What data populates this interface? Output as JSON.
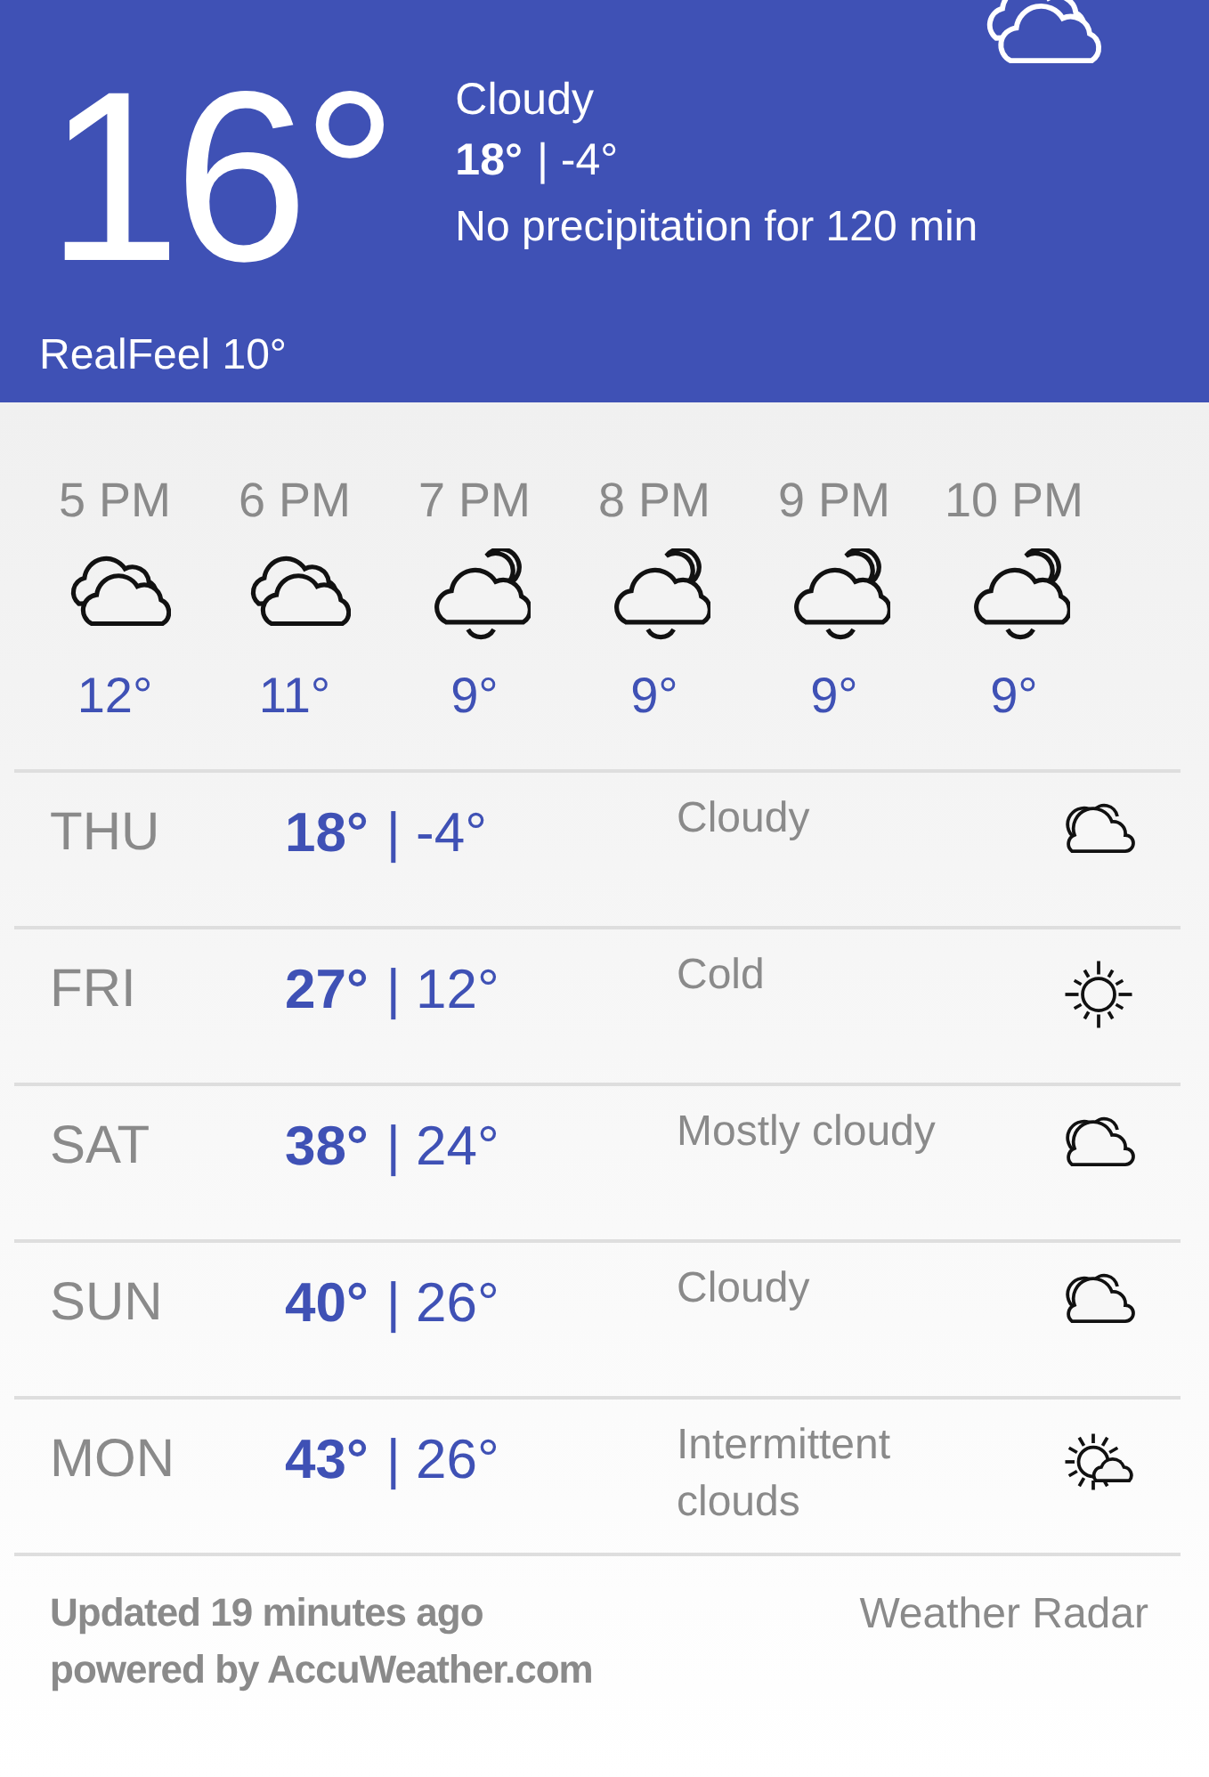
{
  "current": {
    "temperature": "16°",
    "condition": "Cloudy",
    "high": "18°",
    "low": "| -4°",
    "precipitation": "No precipitation for 120 min",
    "realfeel": "RealFeel 10°",
    "kind": "clouds"
  },
  "hourly": [
    {
      "time": "5 PM",
      "kind": "clouds",
      "temp": "12°"
    },
    {
      "time": "6 PM",
      "kind": "clouds",
      "temp": "11°"
    },
    {
      "time": "7 PM",
      "kind": "night_cloud",
      "temp": "9°"
    },
    {
      "time": "8 PM",
      "kind": "night_cloud",
      "temp": "9°"
    },
    {
      "time": "9 PM",
      "kind": "night_cloud",
      "temp": "9°"
    },
    {
      "time": "10 PM",
      "kind": "night_cloud",
      "temp": "9°"
    }
  ],
  "daily": [
    {
      "day": "THU",
      "high": "18°",
      "low": "| -4°",
      "condition": "Cloudy",
      "kind": "cloud"
    },
    {
      "day": "FRI",
      "high": "27°",
      "low": "| 12°",
      "condition": "Cold",
      "kind": "sun"
    },
    {
      "day": "SAT",
      "high": "38°",
      "low": "| 24°",
      "condition": "Mostly cloudy",
      "kind": "cloud"
    },
    {
      "day": "SUN",
      "high": "40°",
      "low": "| 26°",
      "condition": "Cloudy",
      "kind": "cloud"
    },
    {
      "day": "MON",
      "high": "43°",
      "low": "| 26°",
      "condition": "Intermittent clouds",
      "kind": "sun_cloud"
    }
  ],
  "footer": {
    "updated": "Updated 19 minutes ago",
    "powered_by": "powered by AccuWeather.com",
    "radar_link": "Weather Radar"
  }
}
